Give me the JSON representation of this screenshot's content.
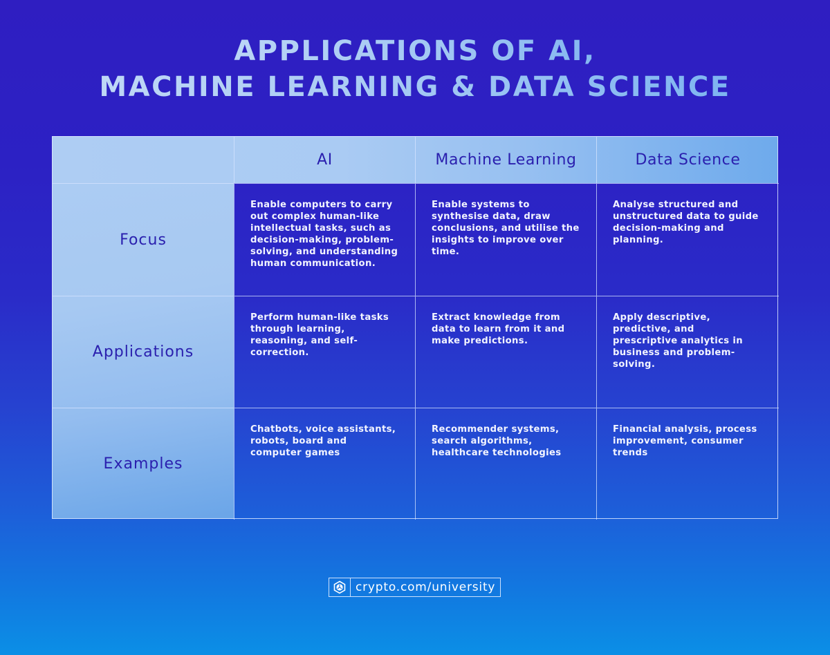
{
  "title": {
    "line1": "Applications of AI,",
    "line2": "Machine Learning & Data Science"
  },
  "table": {
    "columns": [
      "",
      "AI",
      "Machine Learning",
      "Data Science"
    ],
    "rows": [
      {
        "label": "Focus",
        "cells": [
          "Enable computers to carry out complex human-like intellectual tasks, such as decision-making, problem-solving, and understanding human communication.",
          "Enable systems to synthesise data, draw conclusions, and utilise the insights to improve over time.",
          "Analyse structured and unstructured data to guide decision-making and planning."
        ]
      },
      {
        "label": "Applications",
        "cells": [
          "Perform human-like tasks through learning, reasoning, and self-correction.",
          "Extract knowledge from data to learn from it and make predictions.",
          "Apply descriptive, predictive, and prescriptive analytics in business and problem-solving."
        ]
      },
      {
        "label": "Examples",
        "cells": [
          "Chatbots, voice assistants, robots, board and computer games",
          "Recommender systems, search algorithms, healthcare technologies",
          "Financial analysis, process improvement, consumer trends"
        ]
      }
    ]
  },
  "footer": {
    "logo_icon": "crypto-com-logo-icon",
    "url": "crypto.com/university"
  },
  "colors": {
    "background_top": "#2f1ec1",
    "background_bottom": "#0b8fe6",
    "header_text": "#2a1fae",
    "body_text": "#f2f4ff",
    "title_light": "#c3daf7",
    "title_accent": "#6fabef"
  }
}
